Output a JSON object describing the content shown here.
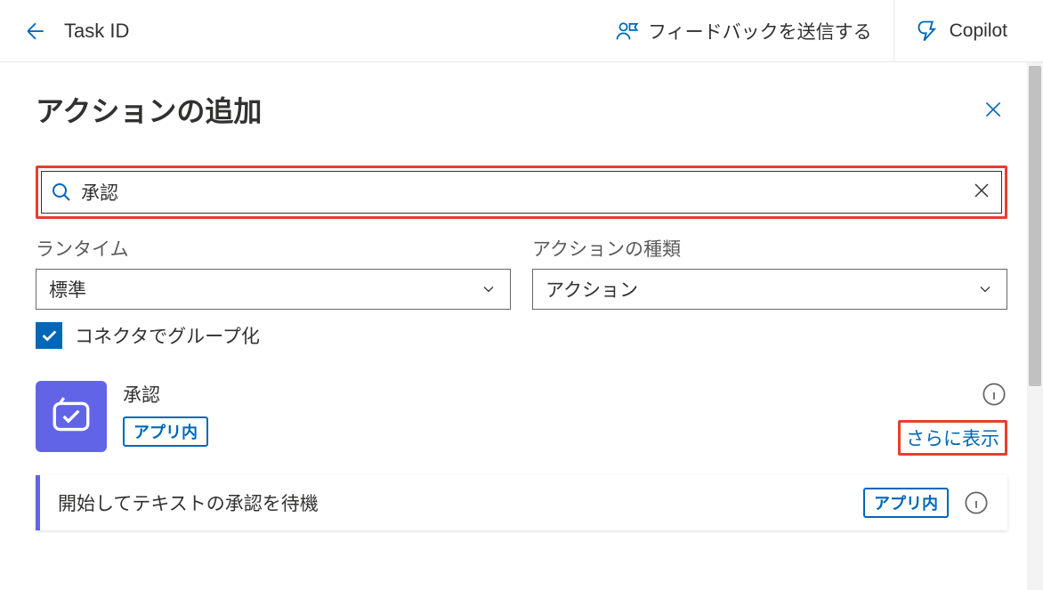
{
  "header": {
    "title": "Task ID",
    "feedback_label": "フィードバックを送信する",
    "copilot_label": "Copilot"
  },
  "panel": {
    "title": "アクションの追加"
  },
  "search": {
    "value": "承認"
  },
  "filters": {
    "runtime": {
      "label": "ランタイム",
      "value": "標準"
    },
    "action_type": {
      "label": "アクションの種類",
      "value": "アクション"
    }
  },
  "group_checkbox": {
    "label": "コネクタでグループ化",
    "checked": true
  },
  "connector": {
    "name": "承認",
    "badge": "アプリ内",
    "show_more": "さらに表示"
  },
  "action_item": {
    "name": "開始してテキストの承認を待機",
    "badge": "アプリ内"
  },
  "colors": {
    "primary": "#0067b8",
    "connector_bg": "#6264e8",
    "highlight_border": "#e63e30"
  }
}
